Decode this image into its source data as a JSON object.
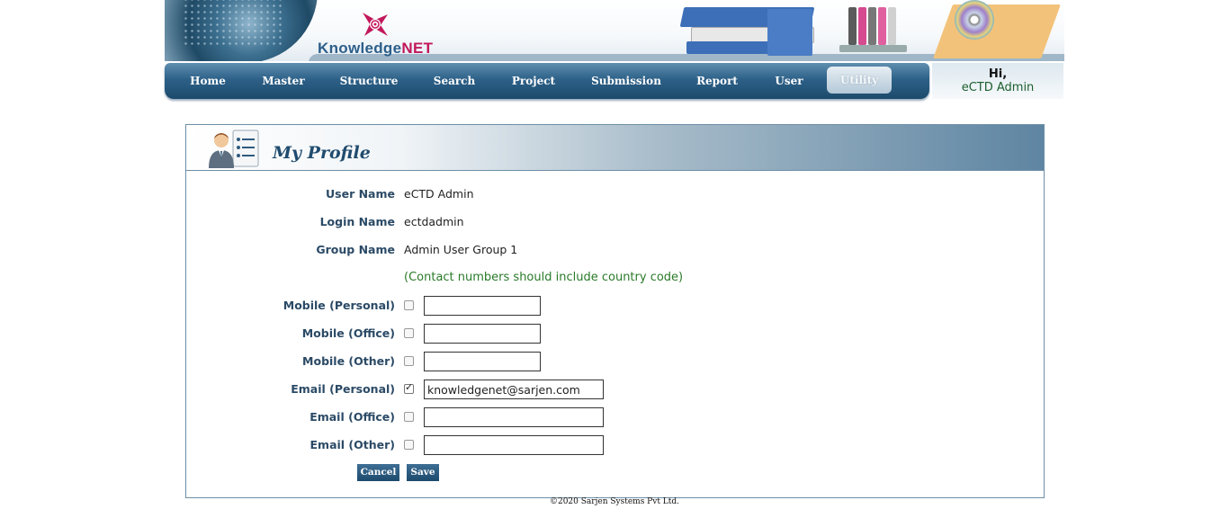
{
  "brand": {
    "logo_prefix": "Knowledge",
    "logo_suffix": "NET"
  },
  "nav": {
    "items": [
      {
        "label": "Home"
      },
      {
        "label": "Master"
      },
      {
        "label": "Structure"
      },
      {
        "label": "Search"
      },
      {
        "label": "Project"
      },
      {
        "label": "Submission"
      },
      {
        "label": "Report"
      },
      {
        "label": "User"
      },
      {
        "label": "Utility",
        "active": true
      }
    ]
  },
  "greeting": {
    "hi": "Hi,",
    "name": "eCTD Admin"
  },
  "profile": {
    "title": "My Profile",
    "fields": {
      "user_name_label": "User Name",
      "user_name_value": "eCTD Admin",
      "login_name_label": "Login Name",
      "login_name_value": "ectdadmin",
      "group_name_label": "Group Name",
      "group_name_value": "Admin User Group 1"
    },
    "hint": "(Contact numbers should include country code)",
    "contacts": [
      {
        "label": "Mobile (Personal)",
        "checked": false,
        "value": ""
      },
      {
        "label": "Mobile (Office)",
        "checked": false,
        "value": ""
      },
      {
        "label": "Mobile (Other)",
        "checked": false,
        "value": ""
      },
      {
        "label": "Email (Personal)",
        "checked": true,
        "value": "knowledgenet@sarjen.com"
      },
      {
        "label": "Email (Office)",
        "checked": false,
        "value": ""
      },
      {
        "label": "Email (Other)",
        "checked": false,
        "value": ""
      }
    ],
    "buttons": {
      "cancel": "Cancel",
      "save": "Save"
    }
  },
  "footer": "©2020 Sarjen Systems Pvt Ltd.",
  "colors": {
    "nav_dark": "#1c4a6c",
    "label": "#2b4a66",
    "hint_green": "#2a7a2a"
  }
}
